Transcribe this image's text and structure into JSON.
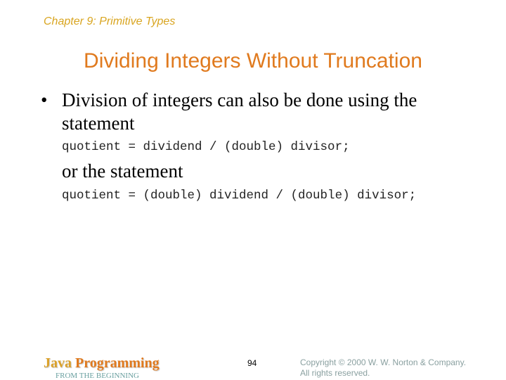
{
  "header": {
    "chapter": "Chapter 9: Primitive Types"
  },
  "slide": {
    "title": "Dividing Integers Without Truncation",
    "bullet_symbol": "•",
    "bullet_text": "Division of integers can also be done using the statement",
    "code_1": "quotient = dividend / (double) divisor;",
    "connector": "or the statement",
    "code_2": "quotient = (double) dividend / (double) divisor;"
  },
  "footer": {
    "logo_word_1": "Java",
    "logo_word_2": "Programming",
    "logo_subtitle": "FROM THE BEGINNING",
    "page_number": "94",
    "copyright_line_1": "Copyright © 2000 W. W. Norton & Company.",
    "copyright_line_2": "All rights reserved."
  },
  "colors": {
    "chapter": "#d9a520",
    "title": "#e07a1e",
    "logo_subtitle": "#6aa0a0",
    "copyright": "#8aa0a0"
  }
}
